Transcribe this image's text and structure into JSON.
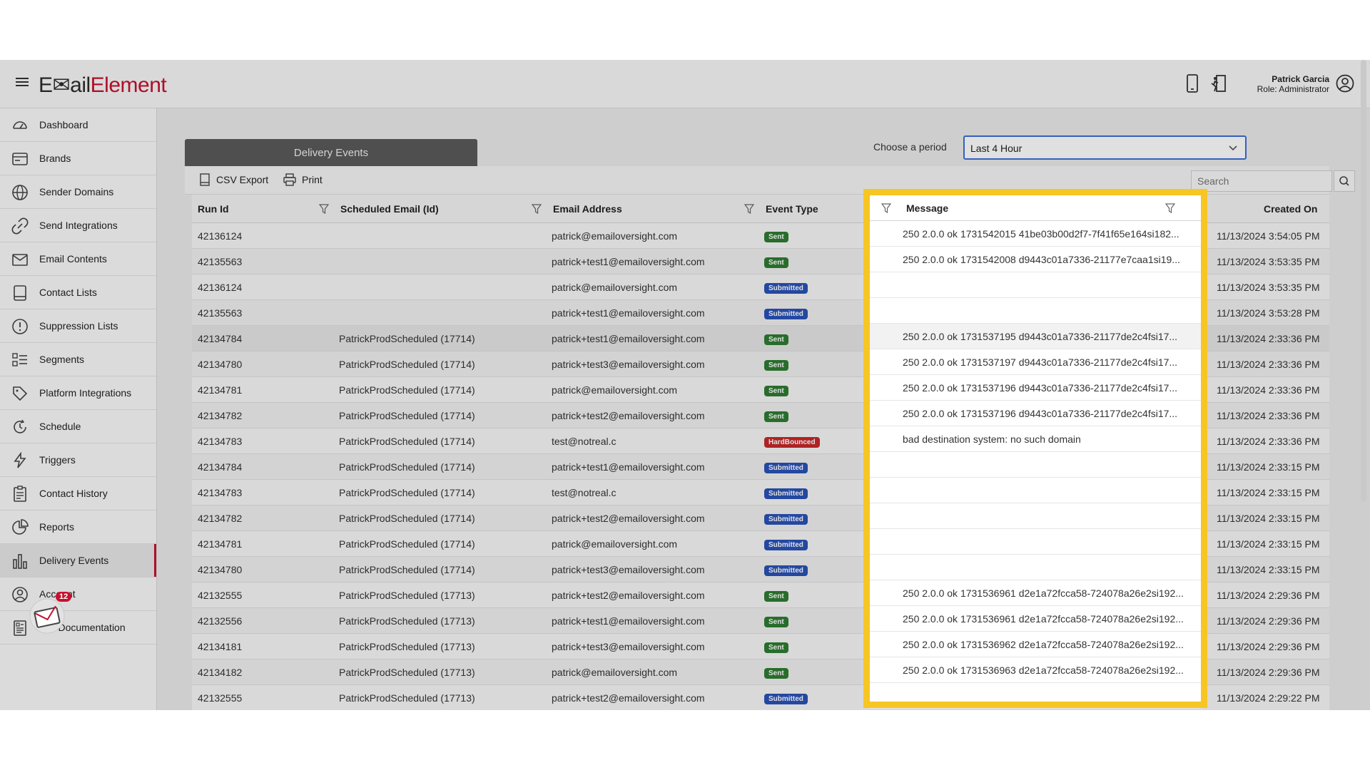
{
  "app": {
    "logo_part1": "E✉ail",
    "logo_part2": "Element",
    "user_name": "Patrick Garcia",
    "user_role": "Role: Administrator",
    "accent": "#c8102e",
    "highlight_color": "#f7c624"
  },
  "sidebar": {
    "items": [
      {
        "label": "Dashboard",
        "icon": "dashboard-icon"
      },
      {
        "label": "Brands",
        "icon": "brands-icon"
      },
      {
        "label": "Sender Domains",
        "icon": "globe-icon"
      },
      {
        "label": "Send Integrations",
        "icon": "link-icon"
      },
      {
        "label": "Email Contents",
        "icon": "envelope-icon"
      },
      {
        "label": "Contact Lists",
        "icon": "list-icon"
      },
      {
        "label": "Suppression Lists",
        "icon": "alert-icon"
      },
      {
        "label": "Segments",
        "icon": "segments-icon"
      },
      {
        "label": "Platform Integrations",
        "icon": "tag-icon"
      },
      {
        "label": "Schedule",
        "icon": "clock-icon"
      },
      {
        "label": "Triggers",
        "icon": "lightning-icon"
      },
      {
        "label": "Contact History",
        "icon": "clipboard-icon"
      },
      {
        "label": "Reports",
        "icon": "pie-icon"
      },
      {
        "label": "Delivery Events",
        "icon": "bar-chart-icon",
        "active": true
      },
      {
        "label": "Account",
        "icon": "user-icon"
      },
      {
        "label": "API Documentation",
        "icon": "document-icon"
      }
    ],
    "mail_badge_count": "12"
  },
  "main": {
    "panel_title": "Delivery Events",
    "period_label": "Choose a period",
    "period_value": "Last 4 Hour",
    "toolbar": {
      "csv_export": "CSV Export",
      "print": "Print",
      "search_placeholder": "Search"
    },
    "columns": {
      "run_id": "Run Id",
      "scheduled": "Scheduled Email (Id)",
      "email": "Email Address",
      "event_type": "Event Type",
      "message": "Message",
      "created_on": "Created On"
    },
    "badge_colors": {
      "Sent": "#2e7d32",
      "Submitted": "#2952b8",
      "HardBounced": "#c62828"
    },
    "rows": [
      {
        "run": "42136124",
        "sched": "",
        "email": "patrick@emailoversight.com",
        "event": "Sent",
        "msg": "250 2.0.0 ok 1731542015 41be03b00d2f7-7f41f65e164si182...",
        "created": "11/13/2024 3:54:05 PM"
      },
      {
        "run": "42135563",
        "sched": "",
        "email": "patrick+test1@emailoversight.com",
        "event": "Sent",
        "msg": "250 2.0.0 ok 1731542008 d9443c01a7336-21177e7caa1si19...",
        "created": "11/13/2024 3:53:35 PM"
      },
      {
        "run": "42136124",
        "sched": "",
        "email": "patrick@emailoversight.com",
        "event": "Submitted",
        "msg": "",
        "created": "11/13/2024 3:53:35 PM"
      },
      {
        "run": "42135563",
        "sched": "",
        "email": "patrick+test1@emailoversight.com",
        "event": "Submitted",
        "msg": "",
        "created": "11/13/2024 3:53:28 PM"
      },
      {
        "run": "42134784",
        "sched": "PatrickProdScheduled (17714)",
        "email": "patrick+test1@emailoversight.com",
        "event": "Sent",
        "msg": "250 2.0.0 ok 1731537195 d9443c01a7336-21177de2c4fsi17...",
        "created": "11/13/2024 2:33:36 PM"
      },
      {
        "run": "42134780",
        "sched": "PatrickProdScheduled (17714)",
        "email": "patrick+test3@emailoversight.com",
        "event": "Sent",
        "msg": "250 2.0.0 ok 1731537197 d9443c01a7336-21177de2c4fsi17...",
        "created": "11/13/2024 2:33:36 PM"
      },
      {
        "run": "42134781",
        "sched": "PatrickProdScheduled (17714)",
        "email": "patrick@emailoversight.com",
        "event": "Sent",
        "msg": "250 2.0.0 ok 1731537196 d9443c01a7336-21177de2c4fsi17...",
        "created": "11/13/2024 2:33:36 PM"
      },
      {
        "run": "42134782",
        "sched": "PatrickProdScheduled (17714)",
        "email": "patrick+test2@emailoversight.com",
        "event": "Sent",
        "msg": "250 2.0.0 ok 1731537196 d9443c01a7336-21177de2c4fsi17...",
        "created": "11/13/2024 2:33:36 PM"
      },
      {
        "run": "42134783",
        "sched": "PatrickProdScheduled (17714)",
        "email": "test@notreal.c",
        "event": "HardBounced",
        "msg": "bad destination system: no such domain",
        "created": "11/13/2024 2:33:36 PM"
      },
      {
        "run": "42134784",
        "sched": "PatrickProdScheduled (17714)",
        "email": "patrick+test1@emailoversight.com",
        "event": "Submitted",
        "msg": "",
        "created": "11/13/2024 2:33:15 PM"
      },
      {
        "run": "42134783",
        "sched": "PatrickProdScheduled (17714)",
        "email": "test@notreal.c",
        "event": "Submitted",
        "msg": "",
        "created": "11/13/2024 2:33:15 PM"
      },
      {
        "run": "42134782",
        "sched": "PatrickProdScheduled (17714)",
        "email": "patrick+test2@emailoversight.com",
        "event": "Submitted",
        "msg": "",
        "created": "11/13/2024 2:33:15 PM"
      },
      {
        "run": "42134781",
        "sched": "PatrickProdScheduled (17714)",
        "email": "patrick@emailoversight.com",
        "event": "Submitted",
        "msg": "",
        "created": "11/13/2024 2:33:15 PM"
      },
      {
        "run": "42134780",
        "sched": "PatrickProdScheduled (17714)",
        "email": "patrick+test3@emailoversight.com",
        "event": "Submitted",
        "msg": "",
        "created": "11/13/2024 2:33:15 PM"
      },
      {
        "run": "42132555",
        "sched": "PatrickProdScheduled (17713)",
        "email": "patrick+test2@emailoversight.com",
        "event": "Sent",
        "msg": "250 2.0.0 ok 1731536961 d2e1a72fcca58-724078a26e2si192...",
        "created": "11/13/2024 2:29:36 PM"
      },
      {
        "run": "42132556",
        "sched": "PatrickProdScheduled (17713)",
        "email": "patrick+test1@emailoversight.com",
        "event": "Sent",
        "msg": "250 2.0.0 ok 1731536961 d2e1a72fcca58-724078a26e2si192...",
        "created": "11/13/2024 2:29:36 PM"
      },
      {
        "run": "42134181",
        "sched": "PatrickProdScheduled (17713)",
        "email": "patrick+test3@emailoversight.com",
        "event": "Sent",
        "msg": "250 2.0.0 ok 1731536962 d2e1a72fcca58-724078a26e2si192...",
        "created": "11/13/2024 2:29:36 PM"
      },
      {
        "run": "42134182",
        "sched": "PatrickProdScheduled (17713)",
        "email": "patrick@emailoversight.com",
        "event": "Sent",
        "msg": "250 2.0.0 ok 1731536963 d2e1a72fcca58-724078a26e2si192...",
        "created": "11/13/2024 2:29:36 PM"
      },
      {
        "run": "42132555",
        "sched": "PatrickProdScheduled (17713)",
        "email": "patrick+test2@emailoversight.com",
        "event": "Submitted",
        "msg": "",
        "created": "11/13/2024 2:29:22 PM"
      }
    ]
  }
}
